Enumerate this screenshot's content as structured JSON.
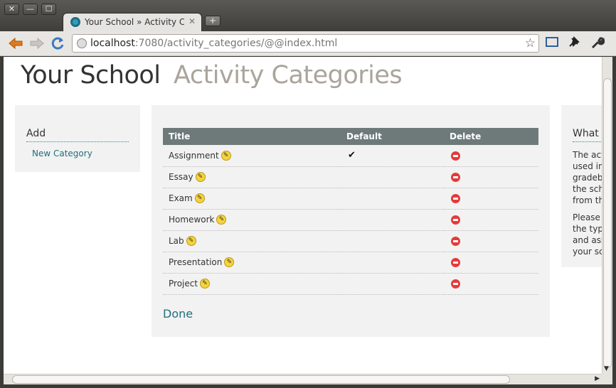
{
  "window": {
    "close": "✕",
    "minimize": "—",
    "maximize": "☐"
  },
  "tab": {
    "title": "Your School » Activity Categories",
    "close": "✕",
    "new_tab": "+"
  },
  "toolbar": {
    "url_host": "localhost",
    "url_rest": ":7080/activity_categories/@@index.html"
  },
  "header": {
    "school": "Your School",
    "section": "Activity Categories"
  },
  "left_panel": {
    "title": "Add",
    "link": "New Category"
  },
  "table": {
    "columns": [
      "Title",
      "Default",
      "Delete"
    ],
    "rows": [
      {
        "title": "Assignment",
        "default": true
      },
      {
        "title": "Essay",
        "default": false
      },
      {
        "title": "Exam",
        "default": false
      },
      {
        "title": "Homework",
        "default": false
      },
      {
        "title": "Lab",
        "default": false
      },
      {
        "title": "Presentation",
        "default": false
      },
      {
        "title": "Project",
        "default": false
      }
    ],
    "check_glyph": "✔",
    "edit_glyph": "✎"
  },
  "done_label": "Done",
  "right_panel": {
    "title": "What i",
    "para1_lines": [
      "The act",
      "used in",
      "gradebo",
      "the scho",
      "from th"
    ],
    "para2_lines": [
      "Please e",
      "the type",
      "and asse",
      "your sch"
    ]
  }
}
